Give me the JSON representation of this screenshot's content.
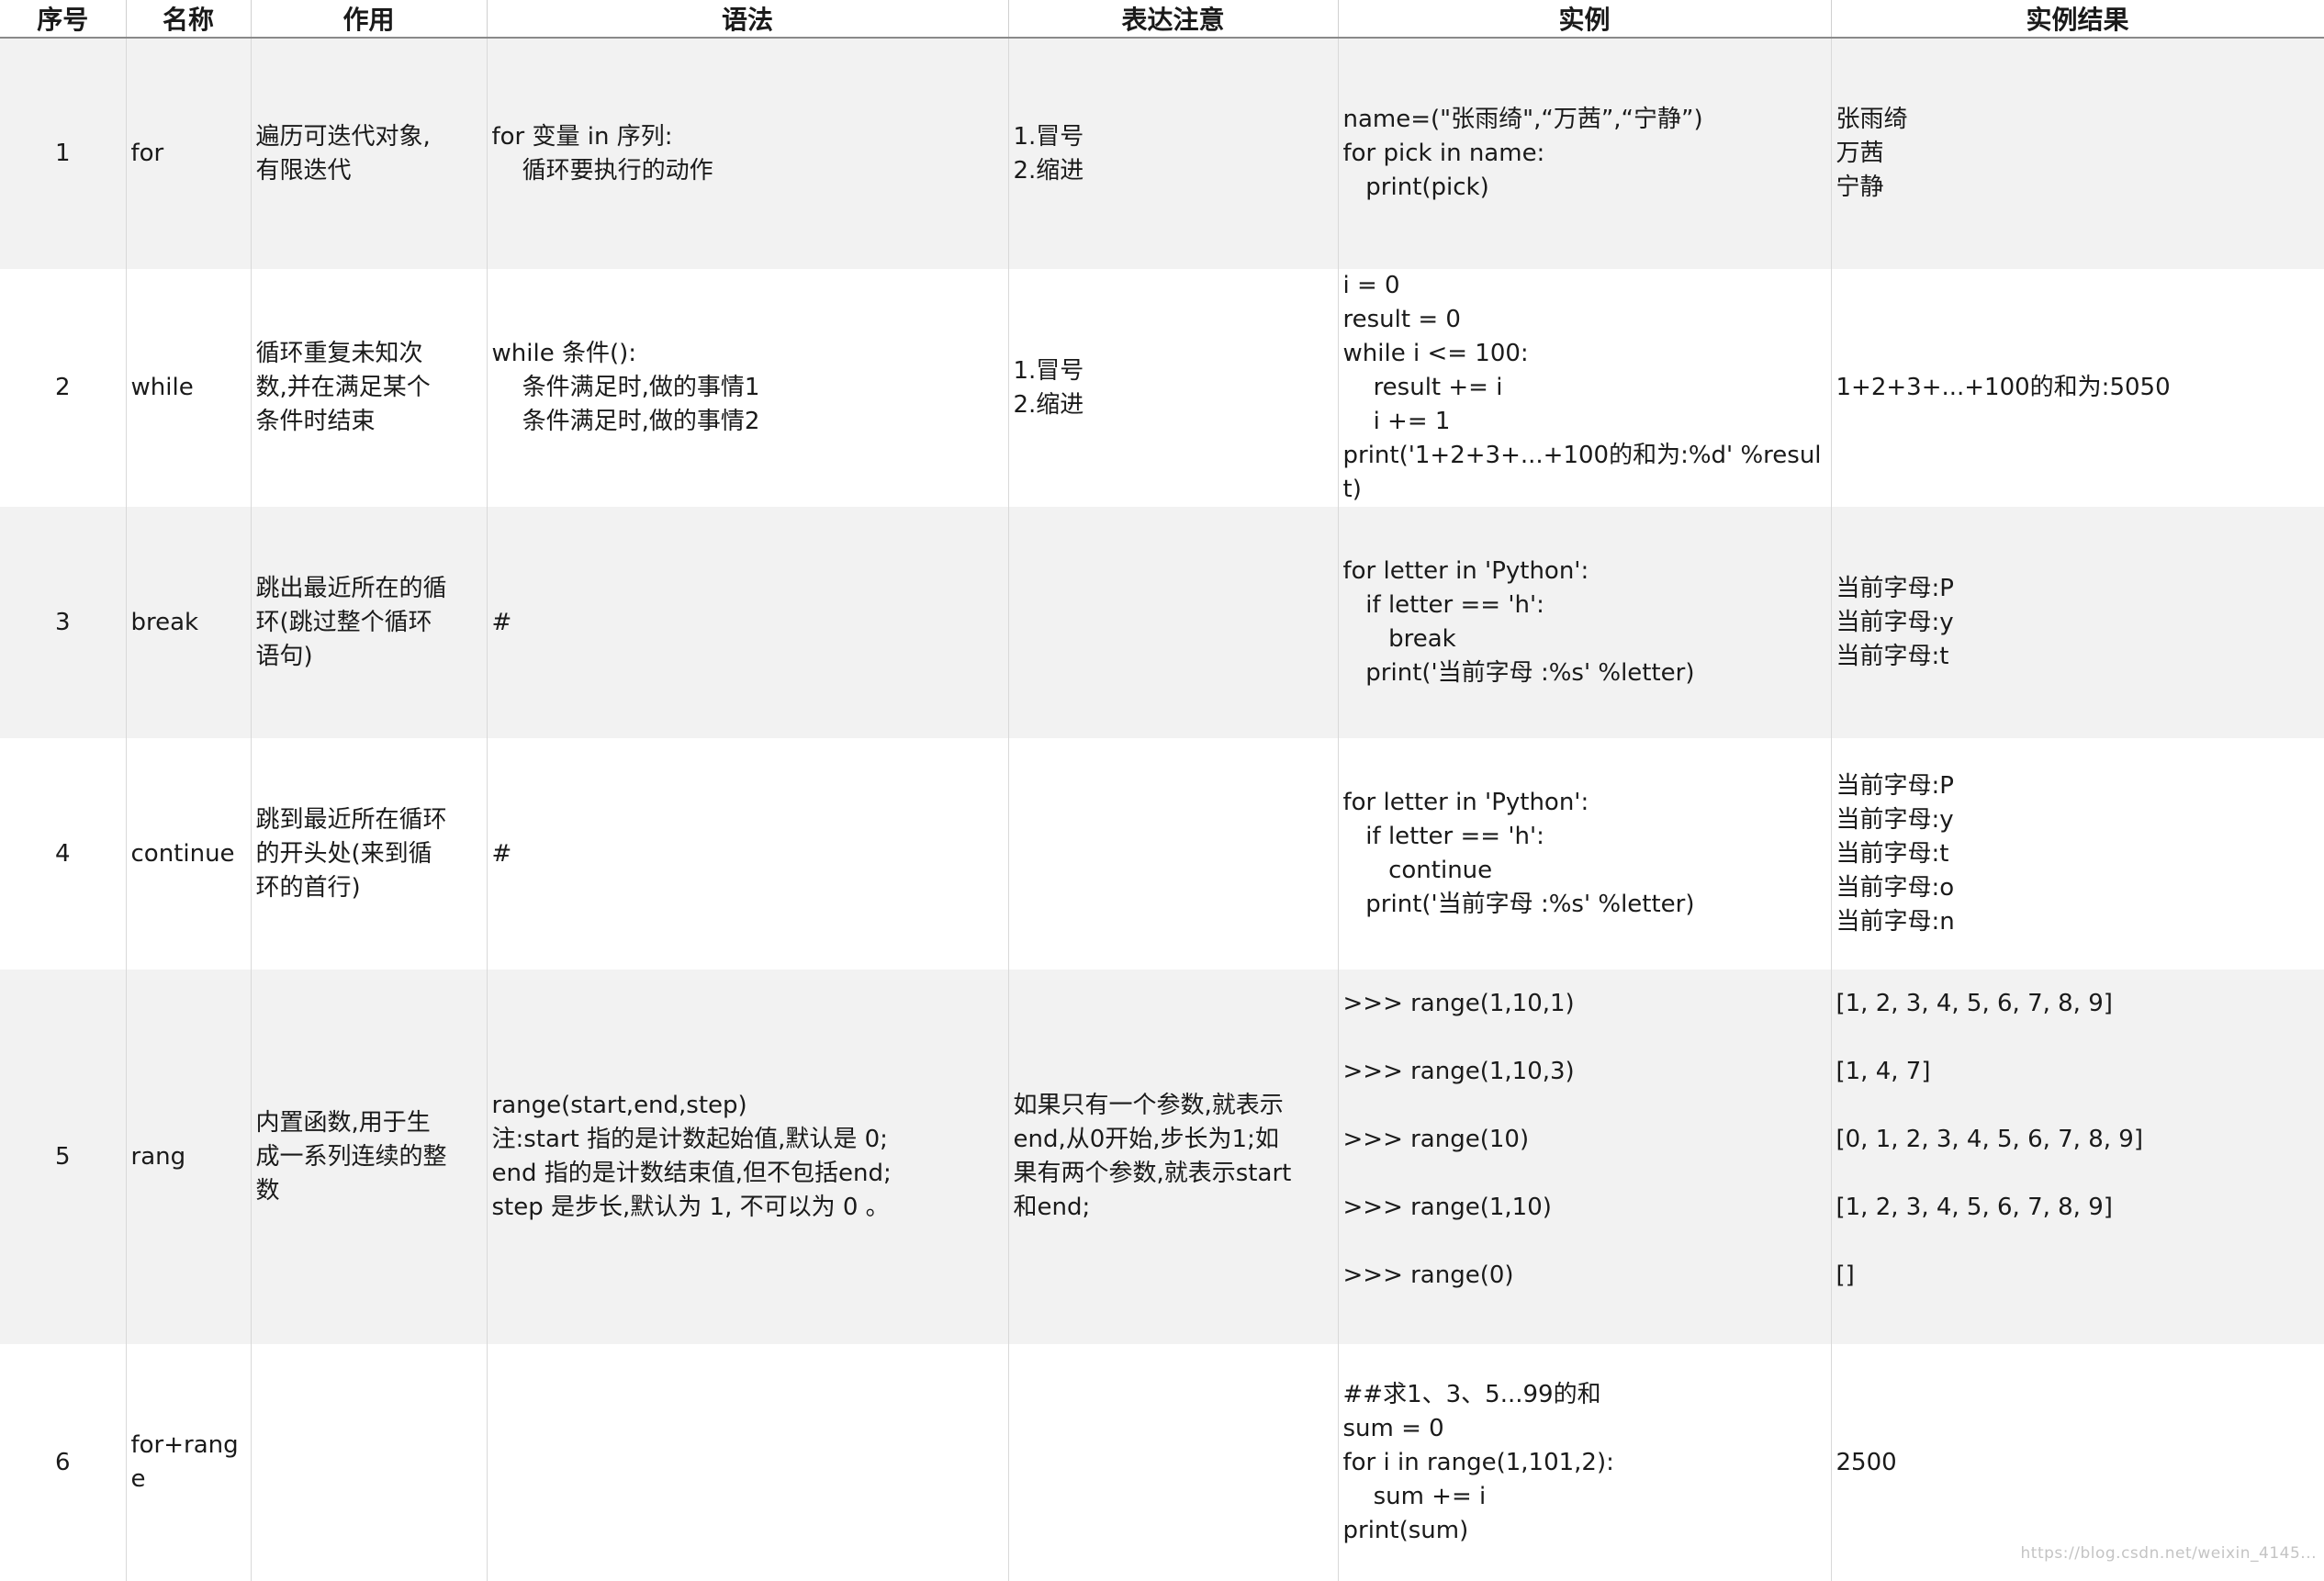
{
  "headers": [
    "序号",
    "名称",
    "作用",
    "语法",
    "表达注意",
    "实例",
    "实例结果"
  ],
  "rows": [
    {
      "no": "1",
      "name": "for",
      "purpose": "遍历可迭代对象,\n有限迭代",
      "syntax": "for 变量 in 序列:\n    循环要执行的动作",
      "notes": "1.冒号\n2.缩进",
      "example": "name=(\"张雨绮\",“万茜”,“宁静”)\nfor pick in name:\n   print(pick)",
      "result": "张雨绮\n万茜\n宁静"
    },
    {
      "no": "2",
      "name": "while",
      "purpose": "循环重复未知次\n数,并在满足某个\n条件时结束",
      "syntax": "while 条件():\n    条件满足时,做的事情1\n    条件满足时,做的事情2",
      "notes": "1.冒号\n2.缩进",
      "example": "i = 0\nresult = 0\nwhile i <= 100:\n    result += i\n    i += 1\nprint('1+2+3+...+100的和为:%d' %result)",
      "result": "1+2+3+...+100的和为:5050"
    },
    {
      "no": "3",
      "name": "break",
      "purpose": "跳出最近所在的循\n环(跳过整个循环\n语句)",
      "syntax": "#",
      "notes": "",
      "example": "for letter in 'Python':\n   if letter == 'h':\n      break\n   print('当前字母 :%s' %letter)",
      "result": "当前字母:P\n当前字母:y\n当前字母:t"
    },
    {
      "no": "4",
      "name": "continue",
      "purpose": "跳到最近所在循环\n的开头处(来到循\n环的首行)",
      "syntax": "#",
      "notes": "",
      "example": "for letter in 'Python':\n   if letter == 'h':\n      continue\n   print('当前字母 :%s' %letter)",
      "result": "当前字母:P\n当前字母:y\n当前字母:t\n当前字母:o\n当前字母:n"
    },
    {
      "no": "5",
      "name": "rang",
      "purpose": "内置函数,用于生\n成一系列连续的整\n数",
      "syntax": "range(start,end,step)\n注:start 指的是计数起始值,默认是 0;\nend 指的是计数结束值,但不包括end;\nstep 是步长,默认为 1, 不可以为 0 。",
      "notes": "如果只有一个参数,就表示\nend,从0开始,步长为1;如\n果有两个参数,就表示start\n和end;",
      "example": ">>> range(1,10,1)\n\n>>> range(1,10,3)\n\n>>> range(10)\n\n>>> range(1,10)\n\n>>> range(0)\n\n",
      "result": "[1, 2, 3, 4, 5, 6, 7, 8, 9]\n\n[1, 4, 7]\n\n[0, 1, 2, 3, 4, 5, 6, 7, 8, 9]\n\n[1, 2, 3, 4, 5, 6, 7, 8, 9]\n\n[]\n\n"
    },
    {
      "no": "6",
      "name": "for+range",
      "purpose": "",
      "syntax": "",
      "notes": "",
      "example": "##求1、3、5...99的和\nsum = 0\nfor i in range(1,101,2):\n    sum += i\nprint(sum)",
      "result": "2500"
    }
  ],
  "watermark": "https://blog.csdn.net/weixin_4145..."
}
